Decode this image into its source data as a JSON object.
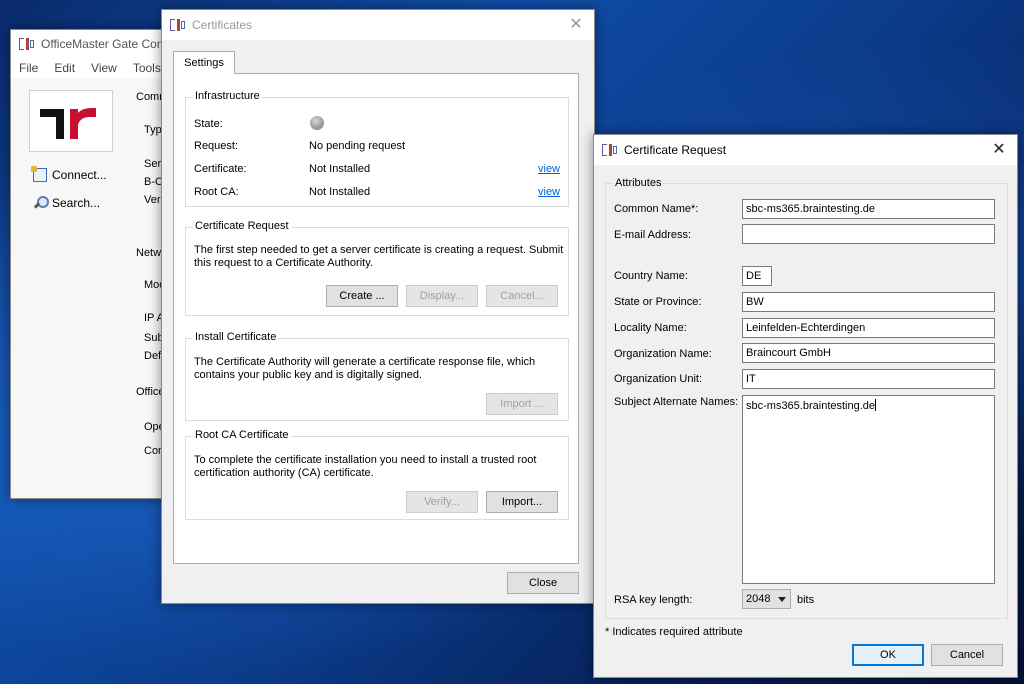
{
  "app_window": {
    "title": "OfficeMaster Gate Conf",
    "menu": [
      "File",
      "Edit",
      "View",
      "Tools"
    ],
    "sidebar": [
      {
        "label": "Connect...",
        "icon": "connect-icon"
      },
      {
        "label": "Search...",
        "icon": "search-icon"
      }
    ],
    "cut_labels": [
      "Comm",
      "Typ",
      "Seri",
      "B-C",
      "Vers",
      "Netw",
      "Mod",
      "IP A",
      "Sub",
      "Defa",
      "Office",
      "Ope",
      "Con"
    ]
  },
  "certificates": {
    "title": "Certificates",
    "tab": "Settings",
    "infrastructure": {
      "title": "Infrastructure",
      "rows": [
        {
          "label": "State:",
          "value": "",
          "link": ""
        },
        {
          "label": "Request:",
          "value": "No pending request",
          "link": ""
        },
        {
          "label": "Certificate:",
          "value": "Not Installed",
          "link": "view"
        },
        {
          "label": "Root CA:",
          "value": "Not Installed",
          "link": "view"
        }
      ]
    },
    "request": {
      "title": "Certificate Request",
      "text": "The first step needed to get a server certificate is creating a request. Submit this request to a Certificate Authority.",
      "buttons": [
        "Create ...",
        "Display...",
        "Cancel..."
      ]
    },
    "install": {
      "title": "Install Certificate",
      "text": "The Certificate Authority will generate a certificate response file, which contains your public key and is digitally signed.",
      "button": "Import ..."
    },
    "rootca": {
      "title": "Root CA Certificate",
      "text": "To complete the certificate installation you need to install a trusted root certification authority (CA) certificate.",
      "buttons": [
        "Verify...",
        "Import..."
      ]
    },
    "close": "Close"
  },
  "request_dialog": {
    "title": "Certificate Request",
    "group": "Attributes",
    "fields": {
      "common_name": {
        "label": "Common Name*:",
        "value": "sbc-ms365.braintesting.de"
      },
      "email": {
        "label": "E-mail Address:",
        "value": ""
      },
      "country": {
        "label": "Country Name:",
        "value": "DE"
      },
      "state": {
        "label": "State or Province:",
        "value": "BW"
      },
      "locality": {
        "label": "Locality Name:",
        "value": "Leinfelden-Echterdingen"
      },
      "org": {
        "label": "Organization Name:",
        "value": "Braincourt GmbH"
      },
      "org_unit": {
        "label": "Organization Unit:",
        "value": "IT"
      },
      "san": {
        "label": "Subject Alternate Names:",
        "value": "sbc-ms365.braintesting.de"
      }
    },
    "rsa": {
      "label": "RSA key length:",
      "value": "2048",
      "unit": "bits"
    },
    "note": "* Indicates required attribute",
    "ok": "OK",
    "cancel": "Cancel"
  }
}
